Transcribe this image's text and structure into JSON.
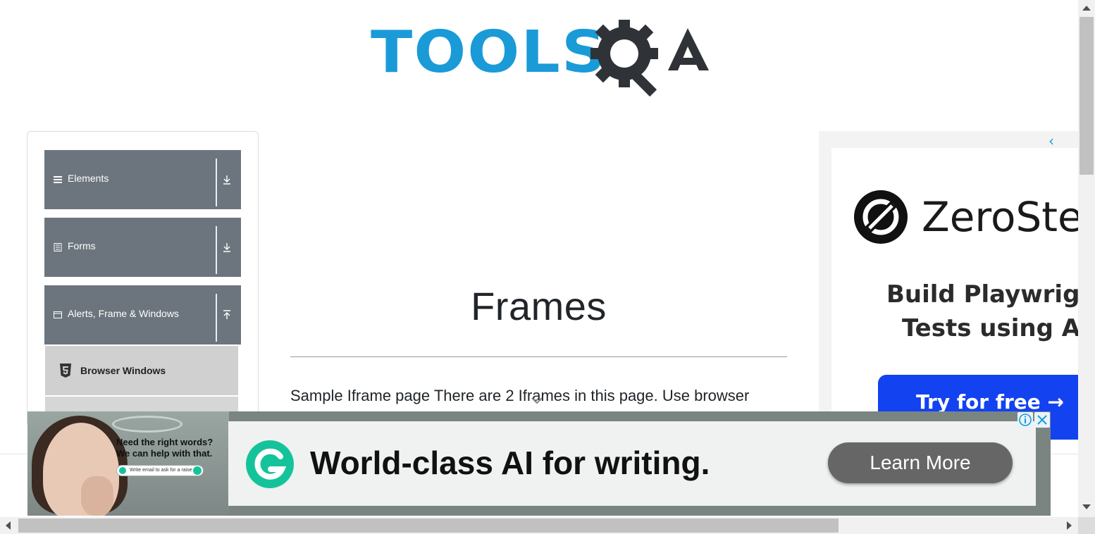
{
  "header": {
    "logo_text": "TOOLS",
    "logo_suffix": "QA",
    "logo_color": "#1a9bd7"
  },
  "sidebar": {
    "groups": [
      {
        "label": "Elements",
        "icon": "list-icon",
        "state": "collapsed"
      },
      {
        "label": "Forms",
        "icon": "form-icon",
        "state": "collapsed"
      },
      {
        "label": "Alerts, Frame & Windows",
        "icon": "window-icon",
        "state": "expanded"
      }
    ],
    "subitems": [
      {
        "label": "Browser Windows",
        "icon": "html5-icon"
      }
    ],
    "group_color": "#6c757d"
  },
  "main": {
    "title": "Frames",
    "description": "Sample Iframe page There are 2 Iframes in this page. Use browser"
  },
  "right_ad": {
    "brand": "ZeroSte",
    "headline_line1": "Build Playwrigh",
    "headline_line2": "Tests using A",
    "cta": "Try for free →",
    "cta_color": "#1342f0"
  },
  "bottom_ad": {
    "photo_text": "Need the right words? We can help with that.",
    "photo_input": "Write email to ask for a raise",
    "headline": "World-class AI for writing.",
    "cta": "Learn More",
    "brand_color": "#15c39a"
  }
}
